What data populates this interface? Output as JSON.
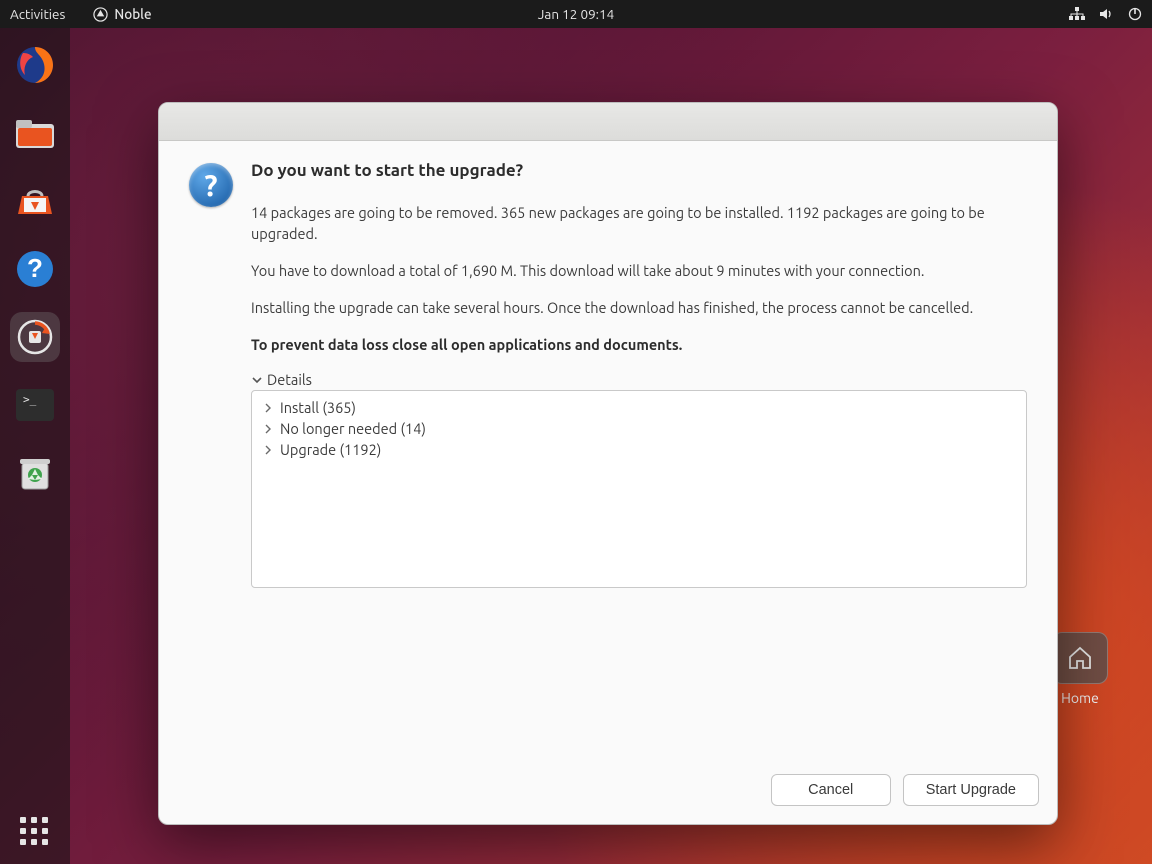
{
  "topbar": {
    "activities": "Activities",
    "app_name": "Noble",
    "clock": "Jan 12  09:14"
  },
  "desktop": {
    "home_label": "Home"
  },
  "dialog": {
    "title": "Do you want to start the upgrade?",
    "summary": "14 packages are going to be removed. 365 new packages are going to be installed. 1192 packages are going to be upgraded.",
    "download_info": "You have to download a total of 1,690 M. This download will take about 9 minutes with your connection.",
    "duration_info": "Installing the upgrade can take several hours. Once the download has finished, the process cannot be cancelled.",
    "warning": "To prevent data loss close all open applications and documents.",
    "details_label": "Details",
    "tree": {
      "install": "Install (365)",
      "no_longer": "No longer needed (14)",
      "upgrade": "Upgrade (1192)"
    },
    "cancel": "Cancel",
    "start": "Start Upgrade"
  }
}
